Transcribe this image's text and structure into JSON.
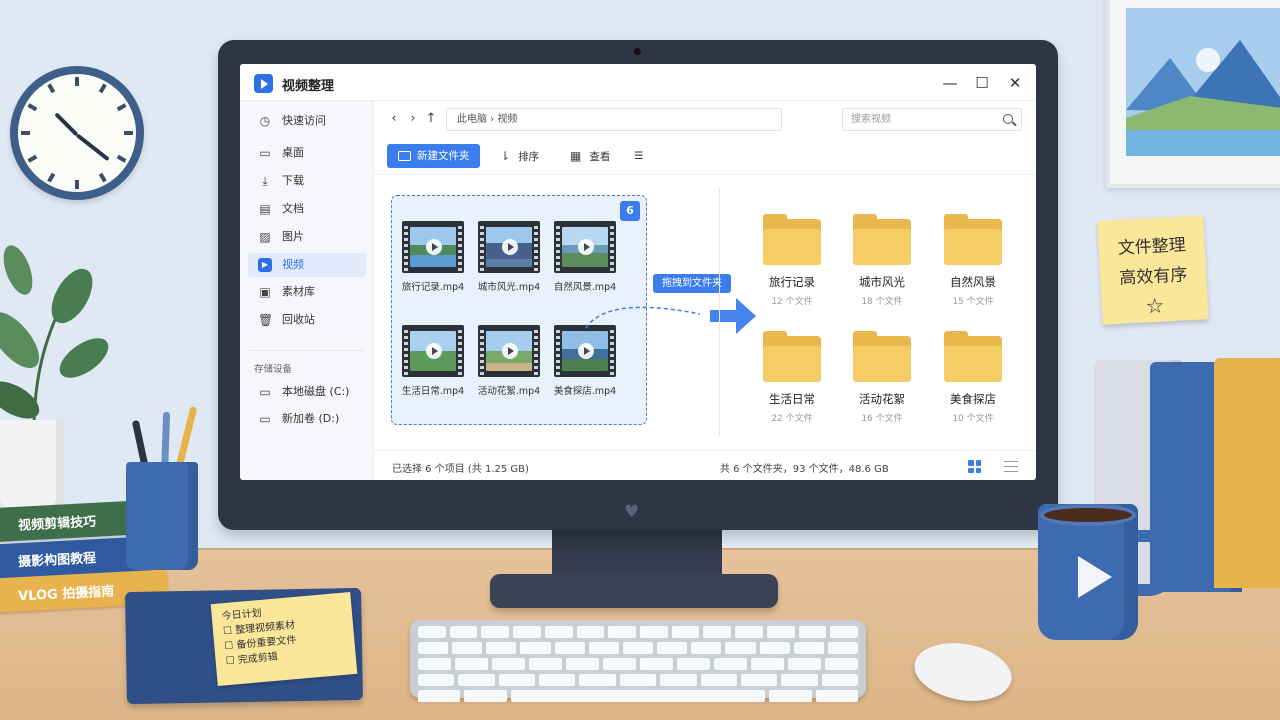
{
  "window": {
    "title": "视频整理",
    "minimize": "—",
    "maximize": "☐",
    "close": "✕"
  },
  "sidebar": {
    "items": [
      {
        "label": "快速访问",
        "icon": "clock-icon",
        "glyph": "◷"
      },
      {
        "label": "桌面",
        "icon": "desktop-icon",
        "glyph": "▭"
      },
      {
        "label": "下载",
        "icon": "download-icon",
        "glyph": "⤓"
      },
      {
        "label": "文档",
        "icon": "document-icon",
        "glyph": "▤"
      },
      {
        "label": "图片",
        "icon": "image-icon",
        "glyph": "▨"
      },
      {
        "label": "视频",
        "icon": "video-icon",
        "glyph": "▶",
        "active": true
      },
      {
        "label": "素材库",
        "icon": "folder-icon",
        "glyph": "▣"
      },
      {
        "label": "回收站",
        "icon": "trash-icon",
        "glyph": "🗑"
      }
    ],
    "storage_label": "存储设备",
    "drives": [
      {
        "label": "本地磁盘 (C:)",
        "icon": "drive-icon",
        "glyph": "▭"
      },
      {
        "label": "新加卷 (D:)",
        "icon": "drive-icon",
        "glyph": "▭"
      }
    ]
  },
  "nav": {
    "back": "‹",
    "forward": "›",
    "up": "↑",
    "path": "此电脑  ›  视频",
    "search_placeholder": "搜索视频"
  },
  "toolbar": {
    "new_folder": "新建文件夹",
    "sort": "排序",
    "view": "查看",
    "more": "☰"
  },
  "selection": {
    "badge": "6",
    "files": [
      {
        "name": "旅行记录.mp4"
      },
      {
        "name": "城市风光.mp4"
      },
      {
        "name": "自然风景.mp4"
      },
      {
        "name": "生活日常.mp4"
      },
      {
        "name": "活动花絮.mp4"
      },
      {
        "name": "美食探店.mp4"
      }
    ],
    "drag_tip": "拖拽到文件夹"
  },
  "folders": [
    {
      "name": "旅行记录",
      "count": "12 个文件"
    },
    {
      "name": "城市风光",
      "count": "18 个文件"
    },
    {
      "name": "自然风景",
      "count": "15 个文件"
    },
    {
      "name": "生活日常",
      "count": "22 个文件"
    },
    {
      "name": "活动花絮",
      "count": "16 个文件"
    },
    {
      "name": "美食探店",
      "count": "10 个文件"
    }
  ],
  "status": {
    "selected": "已选择 6 个项目 (共 1.25 GB)",
    "summary": "共 6 个文件夹，93 个文件，48.6 GB"
  },
  "desk": {
    "wall_note": [
      "文件整理",
      "高效有序 ☆"
    ],
    "books": [
      "视频剪辑技巧",
      "摄影构图教程",
      "VLOG 拍摄指南"
    ],
    "todo": [
      "今日计划",
      "☐ 整理视频素材",
      "☐ 备份重要文件",
      "☐ 完成剪辑"
    ]
  },
  "colors": {
    "accent": "#3b7ded",
    "folder": "#f6cd64",
    "desk": "#e6c29a",
    "wall": "#dfe9f4"
  }
}
